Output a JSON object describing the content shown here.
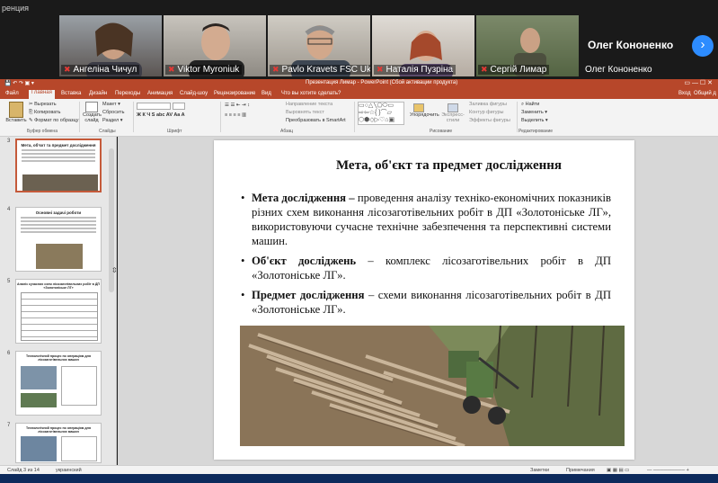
{
  "zoom": {
    "window_title": "ренция",
    "participants": [
      {
        "name": "Ангеліна Чичул"
      },
      {
        "name": "Viktor Myroniuk"
      },
      {
        "name": "Pavlo Kravets FSC Uk..."
      },
      {
        "name": "Наталія Пузріна"
      },
      {
        "name": "Сергій Лимар"
      }
    ],
    "active_name_big": "Олег Кононенко",
    "active_name_small": "Олег Кононенко",
    "next_arrow": "›"
  },
  "powerpoint": {
    "window_title": "Презентация Лимар - PowerPoint (Сбой активации продукта)",
    "user": "Вход",
    "share": "Общий д",
    "tabs": [
      "Файл",
      "Главная",
      "Вставка",
      "Дизайн",
      "Переходы",
      "Анимация",
      "Слайд-шоу",
      "Рецензирование",
      "Вид",
      "Что вы хотите сделать?"
    ],
    "ribbon": {
      "insert_label": "Вставить",
      "cut": "Вырезать",
      "copy": "Копировать",
      "format_painter": "Формат по образцу",
      "clipboard_group": "Буфер обмена",
      "new_slide": "Создать слайд",
      "layout": "Макет",
      "reset": "Сбросить",
      "section": "Раздел",
      "slides_group": "Слайды",
      "font_group": "Шрифт",
      "text_direction": "Направление текста",
      "align_text": "Выровнять текст",
      "smartart": "Преобразовать в SmartArt",
      "paragraph_group": "Абзац",
      "arrange": "Упорядочить",
      "quick_styles": "Экспресс-стили",
      "shape_fill": "Заливка фигуры",
      "shape_outline": "Контур фигуры",
      "shape_effects": "Эффекты фигуры",
      "drawing_group": "Рисование",
      "find": "Найти",
      "replace": "Заменить",
      "select": "Выделить",
      "editing_group": "Редактирование"
    },
    "thumbnails": [
      {
        "num": "3",
        "title": "Мета, об'єкт та предмет дослідження"
      },
      {
        "num": "4",
        "title": "Основні задачі роботи"
      },
      {
        "num": "5",
        "title": "Аналіз сучасних схем лісозаготівельних робіт в ДП «Золотоніське ЛГ»"
      },
      {
        "num": "6",
        "title": "Технологічний процес по операціям для лісозаготівельних машин"
      },
      {
        "num": "7",
        "title": "Технологічний процес по операціям для лісозаготівельних машин"
      }
    ],
    "slide": {
      "title": "Мета, об'єкт та предмет дослідження",
      "bullets": [
        {
          "head": "Мета дослідження –",
          "text": " проведення аналізу техніко-економічних показників різних схем виконання лісозаготівельних робіт в ДП «Золотоніське ЛГ», використовуючи сучасне технічне забезпечення та перспективні системи машин."
        },
        {
          "head": "Об'єкт досліджень",
          "text": " – комплекс лісозаготівельних робіт в ДП «Золотоніське ЛГ»."
        },
        {
          "head": "Предмет дослідження",
          "text": " – схеми виконання лісозаготівельних робіт в ДП «Золотоніське ЛГ»."
        }
      ]
    },
    "status": {
      "slide_of": "Слайд 3 из 14",
      "language": "украинский",
      "notes": "Заметки",
      "comments": "Примечания"
    }
  }
}
